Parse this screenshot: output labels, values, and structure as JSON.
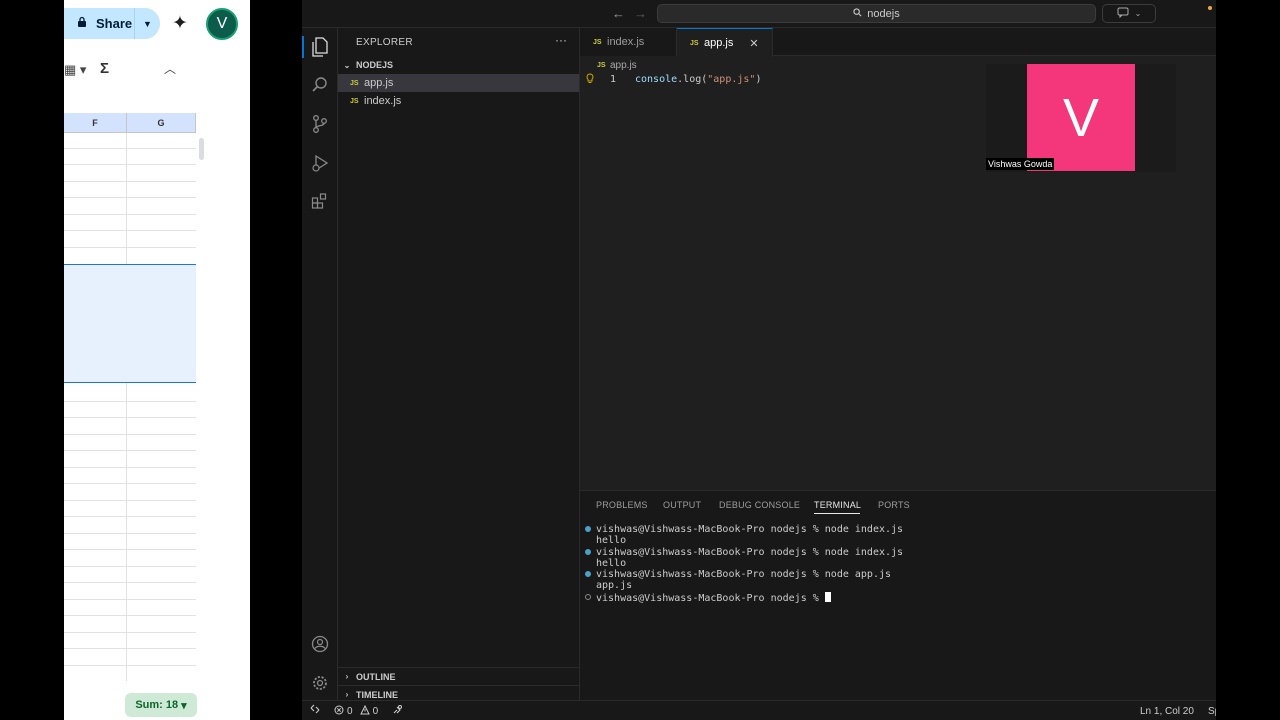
{
  "sheets": {
    "share_label": "Share",
    "avatar_letter": "V",
    "columns": [
      "F",
      "G"
    ],
    "sum_label": "Sum: 18"
  },
  "vscode": {
    "search_text": "nodejs",
    "explorer_title": "EXPLORER",
    "project_name": "NODEJS",
    "files": [
      "app.js",
      "index.js"
    ],
    "js_badge": "JS",
    "outline_label": "OUTLINE",
    "timeline_label": "TIMELINE",
    "tabs": [
      {
        "label": "index.js",
        "active": false
      },
      {
        "label": "app.js",
        "active": true
      }
    ],
    "breadcrumb": "app.js",
    "editor": {
      "line_number": "1",
      "code_fn": "console",
      "code_method": ".log(",
      "code_string": "\"app.js\"",
      "code_close": ")"
    },
    "panel_tabs": [
      "PROBLEMS",
      "OUTPUT",
      "DEBUG CONSOLE",
      "TERMINAL",
      "PORTS"
    ],
    "terminal_lines": [
      "vishwas@Vishwass-MacBook-Pro nodejs % node index.js",
      "hello",
      "vishwas@Vishwass-MacBook-Pro nodejs % node index.js",
      "hello",
      "vishwas@Vishwass-MacBook-Pro nodejs % node app.js",
      "app.js",
      "vishwas@Vishwass-MacBook-Pro nodejs % "
    ],
    "status": {
      "errors": "0",
      "warnings": "0",
      "position": "Ln 1, Col 20",
      "spaces": "Sp"
    }
  },
  "video_tile": {
    "letter": "V",
    "name": "Vishwas Gowda",
    "color": "#f4367a"
  }
}
